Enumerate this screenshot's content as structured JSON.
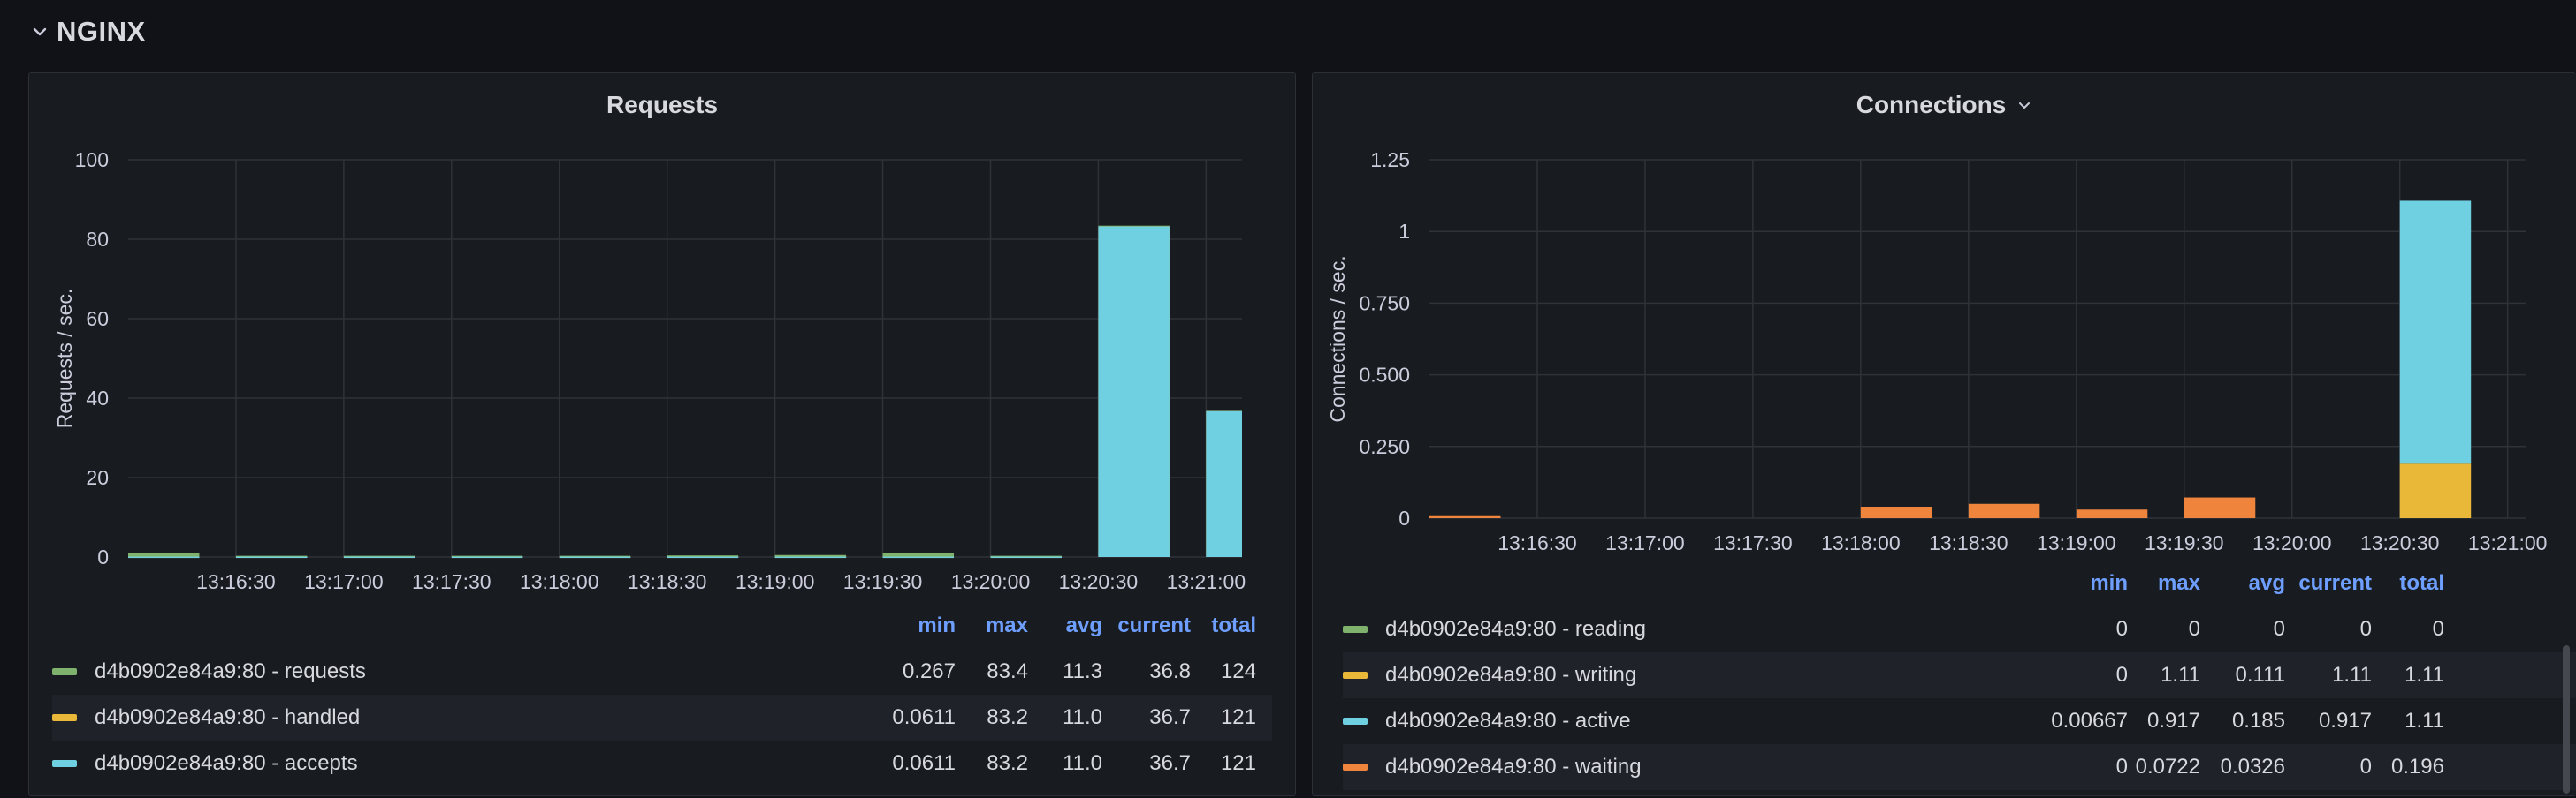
{
  "row": {
    "title": "NGINX",
    "collapse_icon": "chevron-down-icon"
  },
  "requests_panel": {
    "title": "Requests",
    "legend": {
      "headers": [
        "min",
        "max",
        "avg",
        "current",
        "total"
      ],
      "rows": [
        {
          "name": "d4b0902e84a9:80 - requests",
          "color": "#7eb26d",
          "min": "0.267",
          "max": "83.4",
          "avg": "11.3",
          "current": "36.8",
          "total": "124"
        },
        {
          "name": "d4b0902e84a9:80 - handled",
          "color": "#eab839",
          "min": "0.0611",
          "max": "83.2",
          "avg": "11.0",
          "current": "36.7",
          "total": "121"
        },
        {
          "name": "d4b0902e84a9:80 - accepts",
          "color": "#6ed0e0",
          "min": "0.0611",
          "max": "83.2",
          "avg": "11.0",
          "current": "36.7",
          "total": "121"
        }
      ]
    }
  },
  "connections_panel": {
    "title": "Connections",
    "title_icon": "chevron-down-icon",
    "legend": {
      "headers": [
        "min",
        "max",
        "avg",
        "current",
        "total"
      ],
      "rows": [
        {
          "name": "d4b0902e84a9:80 - reading",
          "color": "#7eb26d",
          "min": "0",
          "max": "0",
          "avg": "0",
          "current": "0",
          "total": "0"
        },
        {
          "name": "d4b0902e84a9:80 - writing",
          "color": "#eab839",
          "min": "0",
          "max": "1.11",
          "avg": "0.111",
          "current": "1.11",
          "total": "1.11"
        },
        {
          "name": "d4b0902e84a9:80 - active",
          "color": "#6ed0e0",
          "min": "0.00667",
          "max": "0.917",
          "avg": "0.185",
          "current": "0.917",
          "total": "1.11"
        },
        {
          "name": "d4b0902e84a9:80 - waiting",
          "color": "#ef843c",
          "min": "0",
          "max": "0.0722",
          "avg": "0.0326",
          "current": "0",
          "total": "0.196"
        }
      ]
    }
  },
  "chart_data": [
    {
      "type": "bar",
      "title": "Requests",
      "ylabel": "Requests / sec.",
      "xlabel": "",
      "ylim": [
        0,
        100
      ],
      "yticks": [
        0,
        20,
        40,
        60,
        80,
        100
      ],
      "x_ticks": [
        "13:16:30",
        "13:17:00",
        "13:17:30",
        "13:18:00",
        "13:18:30",
        "13:19:00",
        "13:19:30",
        "13:20:00",
        "13:20:30",
        "13:21:00"
      ],
      "x_range": [
        "13:16:00",
        "13:21:10"
      ],
      "x": [
        "13:16:00",
        "13:16:30",
        "13:17:00",
        "13:17:30",
        "13:18:00",
        "13:18:30",
        "13:19:00",
        "13:19:30",
        "13:20:00",
        "13:20:30",
        "13:21:00"
      ],
      "stacked": false,
      "grid": true,
      "series": [
        {
          "name": "d4b0902e84a9:80 - requests",
          "color": "#7eb26d",
          "values": [
            0.9,
            0.3,
            0.3,
            0.3,
            0.3,
            0.4,
            0.5,
            1.1,
            0.3,
            83.4,
            36.8
          ]
        },
        {
          "name": "d4b0902e84a9:80 - handled",
          "color": "#eab839",
          "values": [
            0.1,
            0.1,
            0.1,
            0.1,
            0.1,
            0.1,
            0.1,
            0.1,
            0.1,
            83.2,
            36.7
          ]
        },
        {
          "name": "d4b0902e84a9:80 - accepts",
          "color": "#6ed0e0",
          "values": [
            0.1,
            0.1,
            0.1,
            0.1,
            0.1,
            0.1,
            0.1,
            0.1,
            0.1,
            83.2,
            36.7
          ]
        }
      ]
    },
    {
      "type": "bar",
      "title": "Connections",
      "ylabel": "Connections / sec.",
      "xlabel": "",
      "ylim": [
        0,
        1.25
      ],
      "yticks": [
        0,
        0.25,
        0.5,
        0.75,
        1,
        1.25
      ],
      "ytick_labels": [
        "0",
        "0.250",
        "0.500",
        "0.750",
        "1",
        "1.25"
      ],
      "x_ticks": [
        "13:16:30",
        "13:17:00",
        "13:17:30",
        "13:18:00",
        "13:18:30",
        "13:19:00",
        "13:19:30",
        "13:20:00",
        "13:20:30",
        "13:21:00"
      ],
      "x_range": [
        "13:16:00",
        "13:21:05"
      ],
      "x": [
        "13:16:00",
        "13:16:30",
        "13:17:00",
        "13:17:30",
        "13:18:00",
        "13:18:30",
        "13:19:00",
        "13:19:30",
        "13:20:00",
        "13:20:30"
      ],
      "stacked": true,
      "grid": true,
      "series": [
        {
          "name": "d4b0902e84a9:80 - reading",
          "color": "#7eb26d",
          "values": [
            0,
            0,
            0,
            0,
            0,
            0,
            0,
            0,
            0,
            0
          ]
        },
        {
          "name": "d4b0902e84a9:80 - writing",
          "color": "#eab839",
          "values": [
            0,
            0,
            0,
            0,
            0,
            0,
            0,
            0,
            0,
            0.19
          ]
        },
        {
          "name": "d4b0902e84a9:80 - active",
          "color": "#6ed0e0",
          "values": [
            0,
            0,
            0,
            0,
            0,
            0,
            0,
            0,
            0,
            0.917
          ]
        },
        {
          "name": "d4b0902e84a9:80 - waiting",
          "color": "#ef843c",
          "values": [
            0.01,
            0,
            0,
            0,
            0.04,
            0.05,
            0.03,
            0.0722,
            0,
            0
          ]
        }
      ]
    }
  ]
}
